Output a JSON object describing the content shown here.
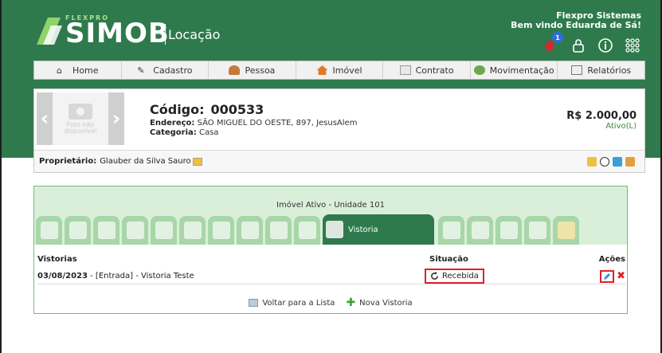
{
  "header": {
    "logo_small": "FLEXPRO",
    "logo_main": "SIMOB",
    "logo_sub": "Locação",
    "company_name": "Flexpro Sistemas",
    "welcome": "Bem vindo Eduarda de Sá!",
    "notification_count": "1"
  },
  "menu": [
    {
      "label": "Home",
      "icon": "home-icon"
    },
    {
      "label": "Cadastro",
      "icon": "pencil-icon"
    },
    {
      "label": "Pessoa",
      "icon": "person-icon"
    },
    {
      "label": "Imóvel",
      "icon": "house-icon"
    },
    {
      "label": "Contrato",
      "icon": "document-icon"
    },
    {
      "label": "Movimentação",
      "icon": "money-icon"
    },
    {
      "label": "Relatórios",
      "icon": "report-icon"
    }
  ],
  "property": {
    "photo_placeholder_line1": "Foto não",
    "photo_placeholder_line2": "disponível",
    "codigo_label": "Código:",
    "codigo_value": "000533",
    "endereco_label": "Endereço:",
    "endereco_value": "SÃO MIGUEL DO OESTE, 897, JesusAlem",
    "categoria_label": "Categoria:",
    "categoria_value": "Casa",
    "price": "R$ 2.000,00",
    "status": "Ativo(L)",
    "owner_label": "Proprietário:",
    "owner_value": "Glauber da Silva Sauro"
  },
  "panel": {
    "title": "Imóvel Ativo - Unidade 101",
    "active_tab": "Vistoria"
  },
  "vistorias": {
    "col_vistorias": "Vistorias",
    "col_situacao": "Situação",
    "col_acoes": "Ações",
    "rows": [
      {
        "desc_date": "03/08/2023",
        "desc_rest": " - [Entrada] - Vistoria Teste",
        "situacao": "Recebida"
      }
    ]
  },
  "links": {
    "back": "Voltar para a Lista",
    "new": "Nova Vistoria"
  },
  "colors": {
    "brand_green": "#2e7a4d",
    "light_green": "#d9efd9",
    "highlight_red": "#e0202a"
  }
}
